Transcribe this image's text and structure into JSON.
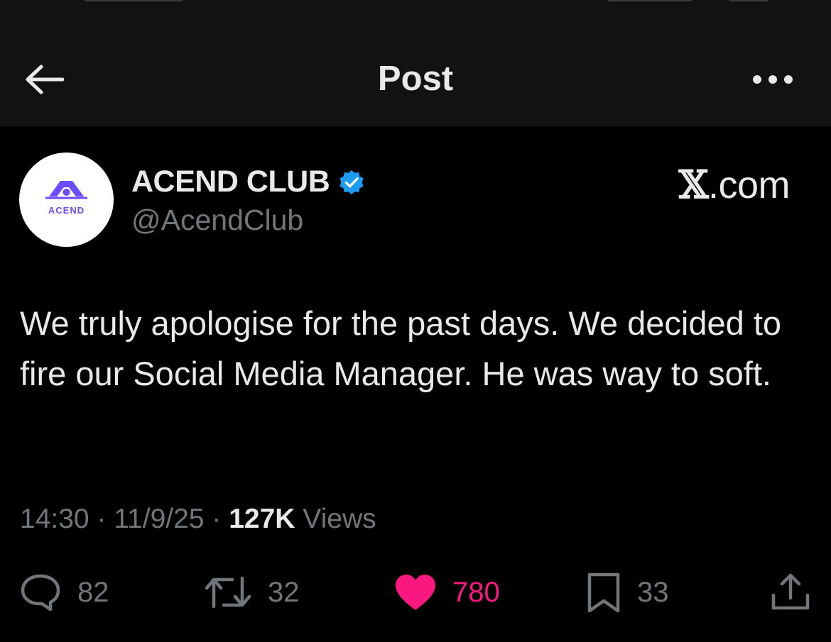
{
  "header": {
    "title": "Post"
  },
  "author": {
    "name": "ACEND CLUB",
    "handle": "@AcendClub",
    "avatar_text": "ACEND",
    "verified": true
  },
  "source": {
    "label_x": "𝕏",
    "label_rest": ".com"
  },
  "post": {
    "text": "We truly apologise for the past days. We decided to fire our Social Media Manager. He was way to soft.",
    "time": "14:30",
    "date": "11/9/25",
    "views_count": "127K",
    "views_label": "Views",
    "separator": "·"
  },
  "actions": {
    "replies": "82",
    "reposts": "32",
    "likes": "780",
    "bookmarks": "33"
  },
  "colors": {
    "background": "#000000",
    "header_bg": "#121212",
    "text_primary": "#e7e9ea",
    "text_secondary": "#71767b",
    "like_accent": "#f91880",
    "verified_blue": "#1d9bf0",
    "avatar_brand": "#6b4dff"
  }
}
